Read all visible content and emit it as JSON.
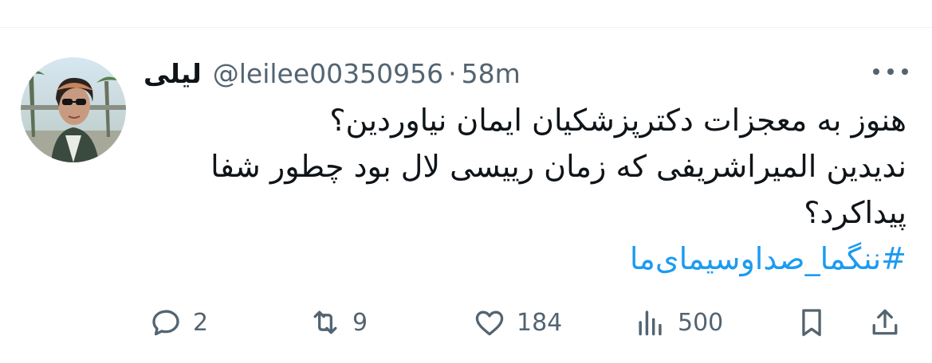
{
  "tweet": {
    "author": {
      "display_name": "لیلی",
      "handle": "@leilee00350956",
      "separator": "·",
      "time": "58m"
    },
    "text_lines": [
      "هنوز به معجزات دکترپزشکیان ایمان نیاوردین؟",
      "ندیدین المیراشریفی که زمان رییسی لال بود چطور شفا",
      "پیداکرد؟"
    ],
    "hashtag": "#ننگما_صداوسیمای‌ما"
  },
  "actions": {
    "reply": {
      "icon": "reply-icon",
      "count": "2"
    },
    "retweet": {
      "icon": "retweet-icon",
      "count": "9"
    },
    "like": {
      "icon": "heart-icon",
      "count": "184"
    },
    "views": {
      "icon": "views-icon",
      "count": "500"
    },
    "bookmark": {
      "icon": "bookmark-icon"
    },
    "share": {
      "icon": "share-icon"
    }
  },
  "colors": {
    "text": "#0f1419",
    "muted": "#536471",
    "link": "#1d9bf0",
    "divider": "#eff3f4"
  }
}
